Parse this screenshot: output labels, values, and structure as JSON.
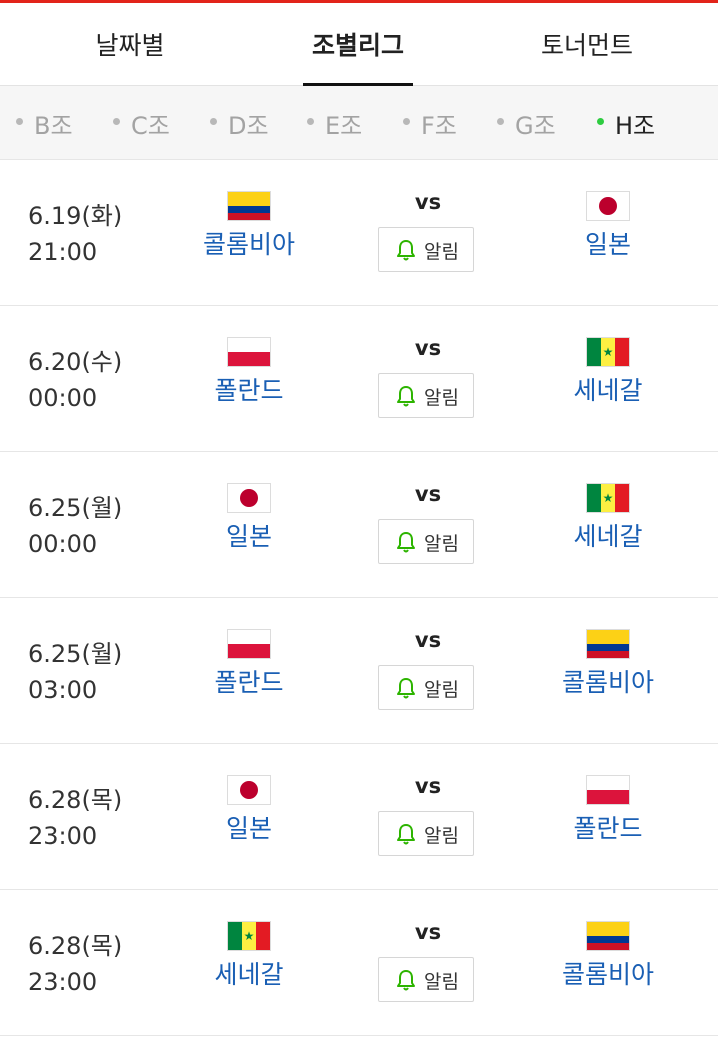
{
  "tabs": [
    {
      "label": "날짜별",
      "active": false
    },
    {
      "label": "조별리그",
      "active": true
    },
    {
      "label": "토너먼트",
      "active": false
    }
  ],
  "groups": [
    {
      "label": "B조",
      "active": false
    },
    {
      "label": "C조",
      "active": false
    },
    {
      "label": "D조",
      "active": false
    },
    {
      "label": "E조",
      "active": false
    },
    {
      "label": "F조",
      "active": false
    },
    {
      "label": "G조",
      "active": false
    },
    {
      "label": "H조",
      "active": true
    }
  ],
  "vs_label": "vs",
  "alarm_label": "알림",
  "colors": {
    "accent_line": "#e2231a",
    "team_name": "#1a5fb4",
    "active_dot": "#2ecc40"
  },
  "matches": [
    {
      "date": "6.19(화)",
      "time": "21:00",
      "home": {
        "name": "콜롬비아",
        "flag": "colombia"
      },
      "away": {
        "name": "일본",
        "flag": "japan"
      }
    },
    {
      "date": "6.20(수)",
      "time": "00:00",
      "home": {
        "name": "폴란드",
        "flag": "poland"
      },
      "away": {
        "name": "세네갈",
        "flag": "senegal"
      }
    },
    {
      "date": "6.25(월)",
      "time": "00:00",
      "home": {
        "name": "일본",
        "flag": "japan"
      },
      "away": {
        "name": "세네갈",
        "flag": "senegal"
      }
    },
    {
      "date": "6.25(월)",
      "time": "03:00",
      "home": {
        "name": "폴란드",
        "flag": "poland"
      },
      "away": {
        "name": "콜롬비아",
        "flag": "colombia"
      }
    },
    {
      "date": "6.28(목)",
      "time": "23:00",
      "home": {
        "name": "일본",
        "flag": "japan"
      },
      "away": {
        "name": "폴란드",
        "flag": "poland"
      }
    },
    {
      "date": "6.28(목)",
      "time": "23:00",
      "home": {
        "name": "세네갈",
        "flag": "senegal"
      },
      "away": {
        "name": "콜롬비아",
        "flag": "colombia"
      }
    }
  ]
}
